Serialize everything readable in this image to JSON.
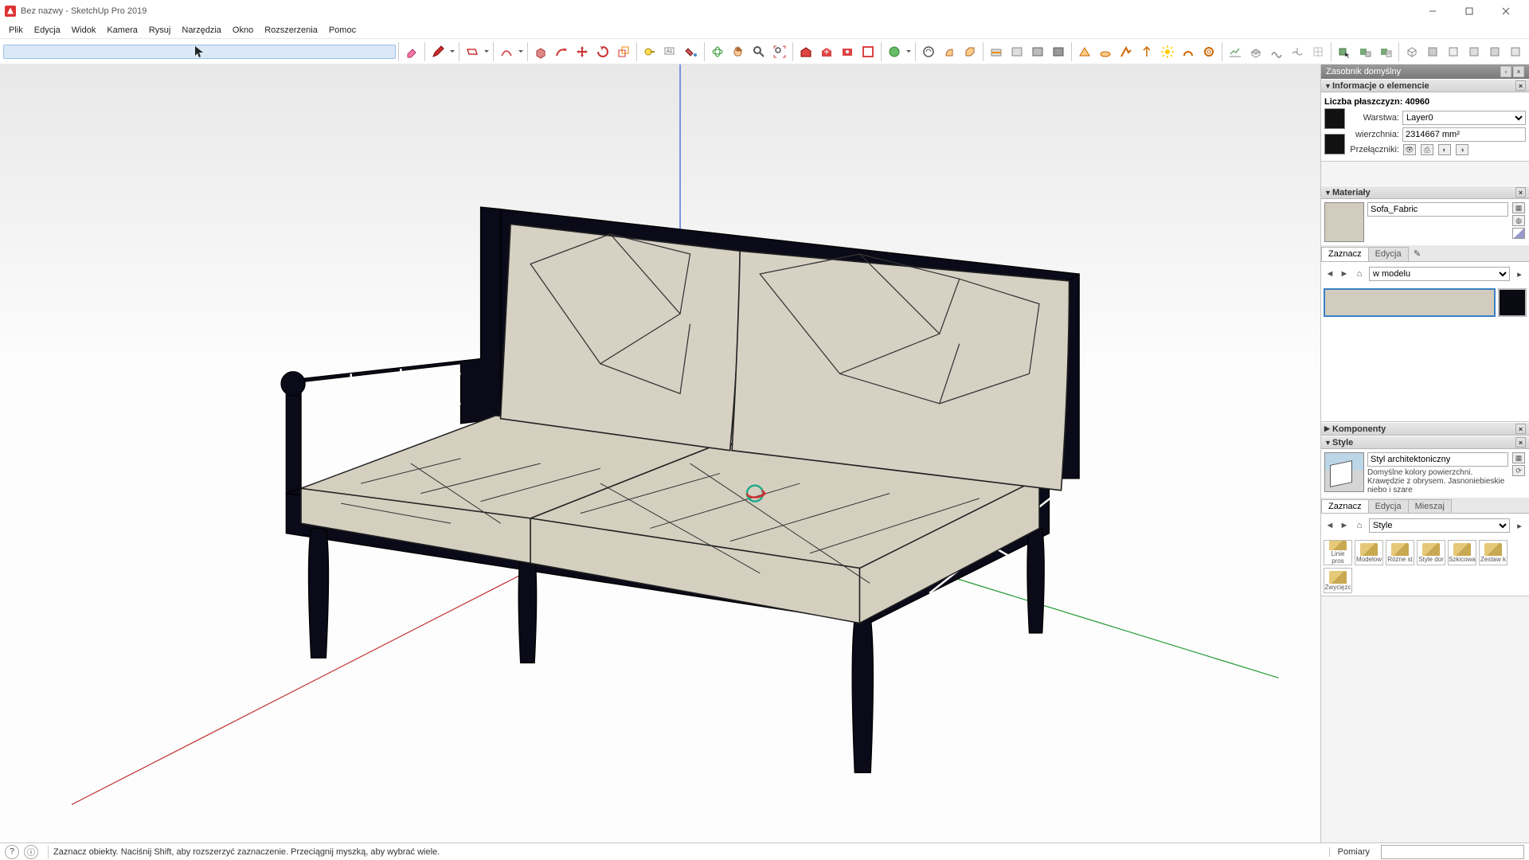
{
  "title": "Bez nazwy - SketchUp Pro 2019",
  "menu": [
    "Plik",
    "Edycja",
    "Widok",
    "Kamera",
    "Rysuj",
    "Narzędzia",
    "Okno",
    "Rozszerzenia",
    "Pomoc"
  ],
  "tray": {
    "title": "Zasobnik domyślny",
    "entity": {
      "header": "Informacje o elemencie",
      "faces_label": "Liczba płaszczyzn: 40960",
      "layer_label": "Warstwa:",
      "layer_value": "Layer0",
      "area_label": "wierzchnia:",
      "area_value": "2314667 mm²",
      "toggles_label": "Przełączniki:"
    },
    "materials": {
      "header": "Materiały",
      "name": "Sofa_Fabric",
      "tab_select": "Zaznacz",
      "tab_edit": "Edycja",
      "scope": "w modelu"
    },
    "components": {
      "header": "Komponenty"
    },
    "styles": {
      "header": "Style",
      "name": "Styl architektoniczny",
      "desc": "Domyślne kolory powierzchni. Krawędzie z obrysem. Jasnoniebieskie niebo i szare",
      "tab_select": "Zaznacz",
      "tab_edit": "Edycja",
      "tab_mix": "Mieszaj",
      "scope": "Style",
      "thumbs": [
        "Linie pros",
        "Modelow",
        "Różne st",
        "Style dor",
        "Szkicowa",
        "Zestaw k",
        "Zwycięzc"
      ]
    }
  },
  "status": {
    "hint": "Zaznacz obiekty. Naciśnij Shift, aby rozszerzyć zaznaczenie. Przeciągnij myszką, aby wybrać wiele.",
    "measure_label": "Pomiary"
  }
}
